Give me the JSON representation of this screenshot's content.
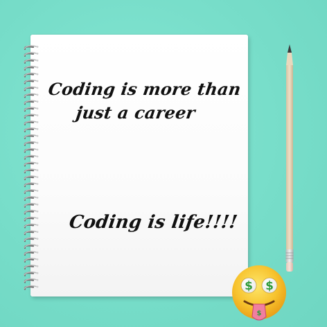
{
  "notebook": {
    "line1": "Coding is more than",
    "line2": "just a career",
    "line3": "Coding is life!!!!"
  },
  "emoji": {
    "name": "money-mouth-face",
    "eye_symbol": "$"
  },
  "colors": {
    "background": "#79e0cc",
    "paper": "#fdfdfd",
    "text": "#111111",
    "pencil_wood": "#e8d5b8",
    "emoji_face": "#f7c32e"
  }
}
